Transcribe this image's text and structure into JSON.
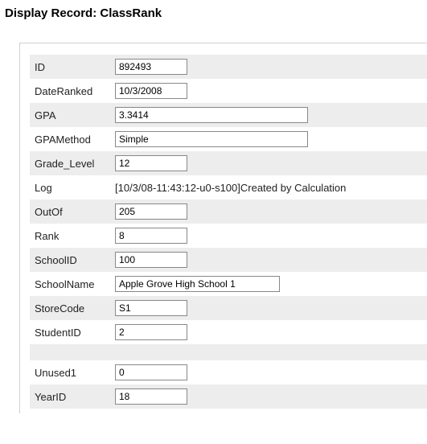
{
  "header": {
    "title": "Display Record: ClassRank"
  },
  "fields": {
    "id": {
      "label": "ID",
      "value": "892493"
    },
    "dateRanked": {
      "label": "DateRanked",
      "value": "10/3/2008"
    },
    "gpa": {
      "label": "GPA",
      "value": "3.3414"
    },
    "gpaMethod": {
      "label": "GPAMethod",
      "value": "Simple"
    },
    "gradeLevel": {
      "label": "Grade_Level",
      "value": "12"
    },
    "log": {
      "label": "Log",
      "value": "[10/3/08-11:43:12-u0-s100]Created by Calculation"
    },
    "outOf": {
      "label": "OutOf",
      "value": "205"
    },
    "rank": {
      "label": "Rank",
      "value": "8"
    },
    "schoolId": {
      "label": "SchoolID",
      "value": "100"
    },
    "schoolName": {
      "label": "SchoolName",
      "value": "Apple Grove High School 1"
    },
    "storeCode": {
      "label": "StoreCode",
      "value": "S1"
    },
    "studentId": {
      "label": "StudentID",
      "value": "2"
    },
    "unused1": {
      "label": "Unused1",
      "value": "0"
    },
    "yearId": {
      "label": "YearID",
      "value": "18"
    }
  }
}
